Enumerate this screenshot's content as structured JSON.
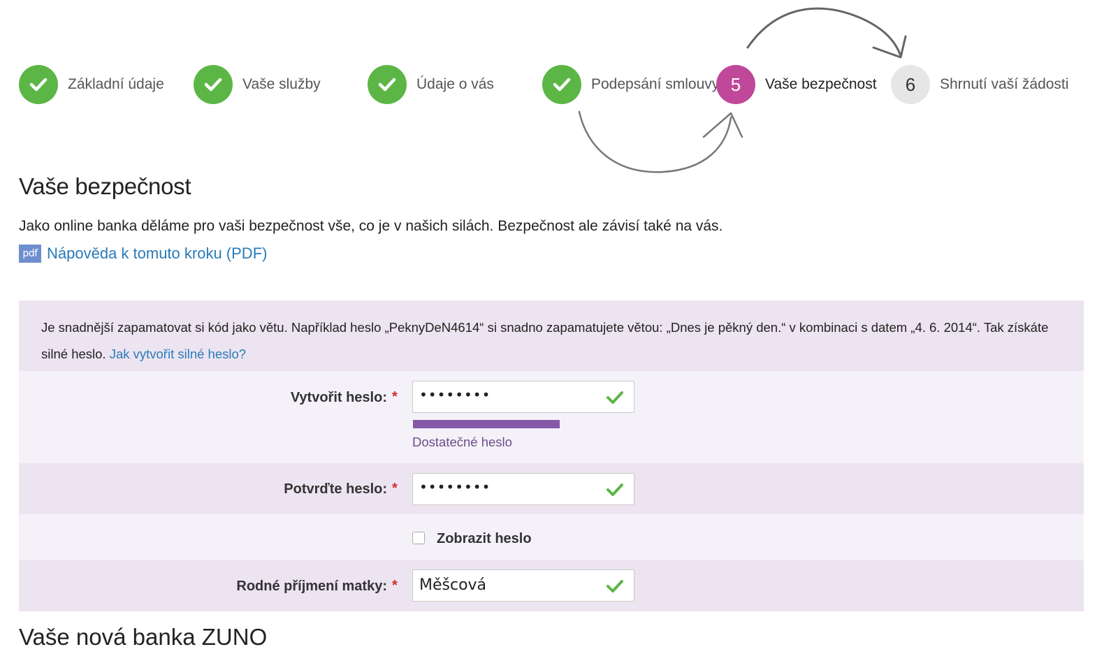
{
  "stepper": {
    "steps": [
      {
        "number": "",
        "label": "Základní údaje",
        "state": "done",
        "icon": "check-icon"
      },
      {
        "number": "",
        "label": "Vaše služby",
        "state": "done",
        "icon": "check-icon"
      },
      {
        "number": "",
        "label": "Údaje o vás",
        "state": "done",
        "icon": "check-icon"
      },
      {
        "number": "",
        "label": "Podepsání smlouvy",
        "state": "done",
        "icon": "check-icon"
      },
      {
        "number": "5",
        "label": "Vaše bezpečnost",
        "state": "active"
      },
      {
        "number": "6",
        "label": "Shrnutí vaší žádosti",
        "state": "future"
      }
    ]
  },
  "page": {
    "title": "Vaše bezpečnost",
    "intro": "Jako online banka děláme pro vaši bezpečnost vše, co je v našich silách. Bezpečnost ale závisí také na vás.",
    "pdf_icon_text": "pdf",
    "help_link": "Nápověda k tomuto kroku (PDF)",
    "next_heading": "Vaše nová banka ZUNO"
  },
  "tip": {
    "text": "Je snadnější zapamatovat si kód jako větu. Například heslo „PeknyDeN4614“ si snadno zapamatujete větou: „Dnes je pěkný den.“ v kombinaci s datem „4. 6. 2014“. Tak získáte silné heslo.",
    "link": "Jak vytvořit silné heslo?"
  },
  "form": {
    "password": {
      "label": "Vytvořit heslo:",
      "required_mark": "*",
      "value": "••••••••",
      "strength_text": "Dostatečné heslo",
      "strength_fraction": 0.66
    },
    "confirm": {
      "label": "Potvrďte heslo:",
      "required_mark": "*",
      "value": "••••••••"
    },
    "show_password": {
      "label": "Zobrazit heslo",
      "checked": false
    },
    "mother_name": {
      "label": "Rodné příjmení matky:",
      "required_mark": "*",
      "value": "Měšcová"
    }
  },
  "colors": {
    "done": "#5cb646",
    "active": "#c0489a",
    "future": "#e6e6e6",
    "link": "#2a7ab8",
    "strength": "#8659a8",
    "panel_dark": "#ece4f1",
    "panel_light": "#f5f1f8",
    "required": "#d62b2b"
  }
}
